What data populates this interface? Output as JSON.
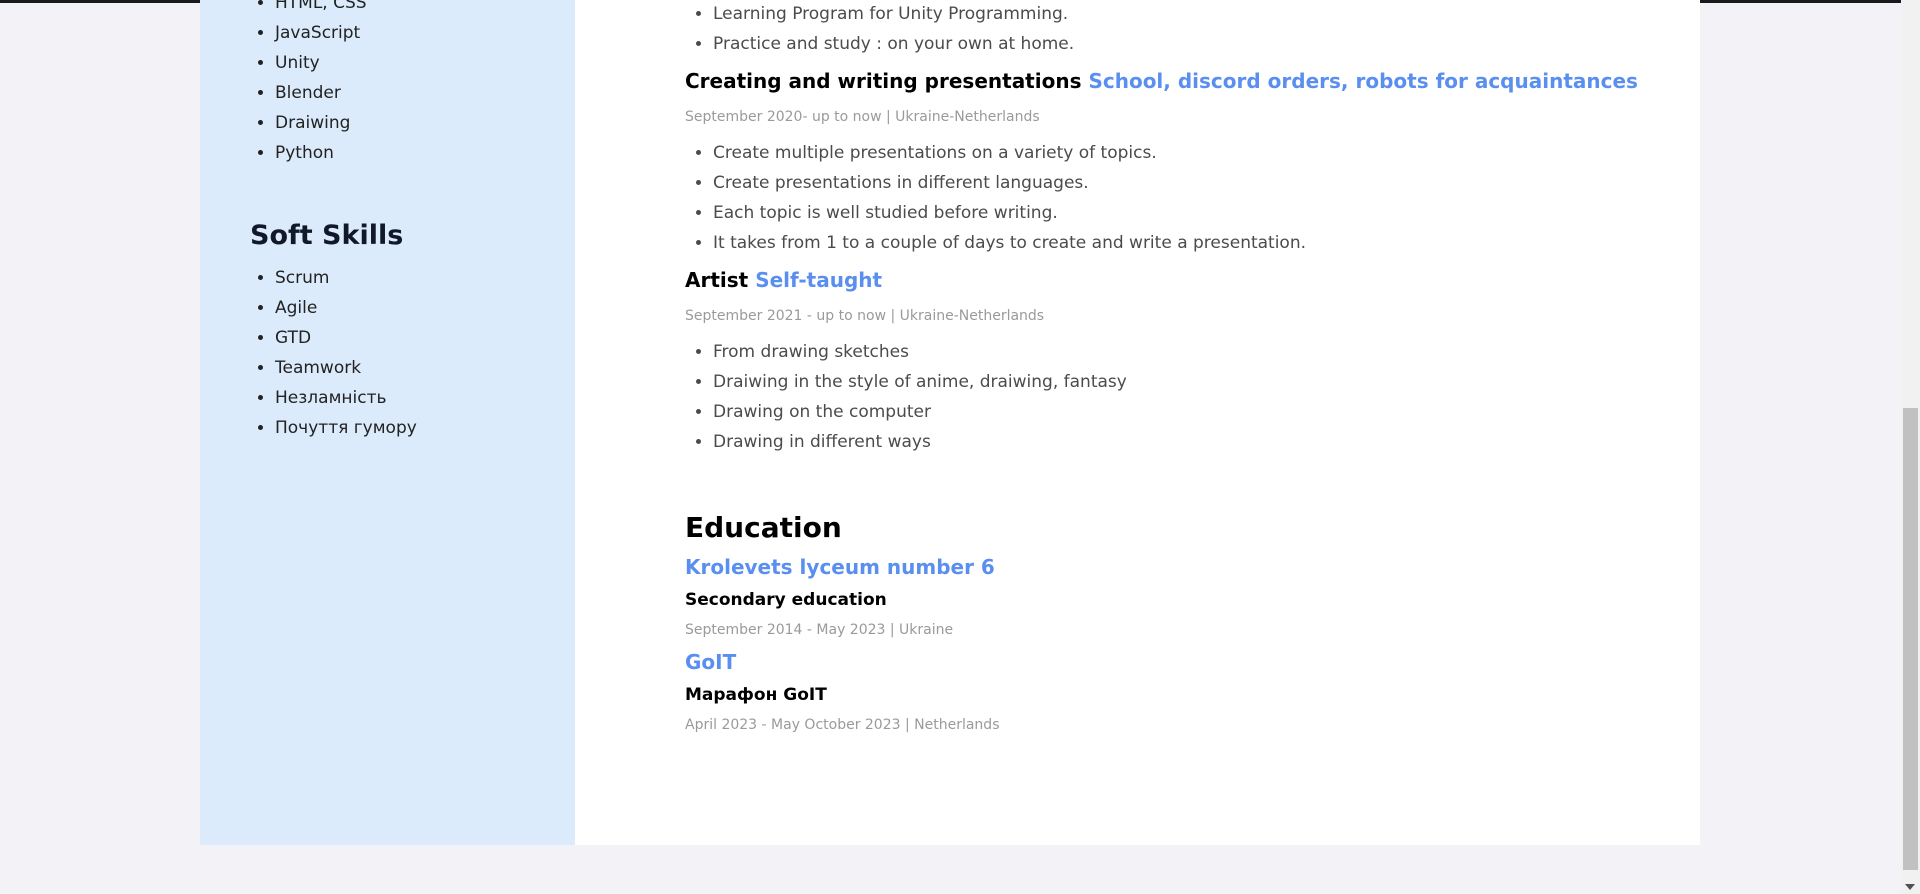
{
  "sidebar": {
    "hard_skills": [
      "HTML, CSS",
      "JavaScript",
      "Unity",
      "Blender",
      "Draiwing",
      "Python"
    ],
    "soft_skills_title": "Soft Skills",
    "soft_skills": [
      "Scrum",
      "Agile",
      "GTD",
      "Teamwork",
      "Незламність",
      "Почуття гумору"
    ]
  },
  "experience": {
    "top_bullets": [
      "Learning Program for Unity Programming.",
      "Practice and study : on your own at home."
    ],
    "jobs": [
      {
        "title": "Creating and writing presentations",
        "org": "School, discord orders, robots for acquaintances",
        "meta": "September 2020- up to now | Ukraine-Netherlands",
        "bullets": [
          "Create multiple presentations on a variety of topics.",
          "Create presentations in different languages.",
          "Each topic is well studied before writing.",
          "It takes from 1 to a couple of days to create and write a presentation."
        ]
      },
      {
        "title": "Artist",
        "org": "Self-taught",
        "meta": "September 2021 - up to now | Ukraine-Netherlands",
        "bullets": [
          "From drawing sketches",
          "Draiwing in the style of anime, draiwing, fantasy",
          "Drawing on the computer",
          "Drawing in different ways"
        ]
      }
    ]
  },
  "education": {
    "title": "Education",
    "items": [
      {
        "name": "Krolevets lyceum number 6",
        "degree": "Secondary education",
        "meta": "September 2014 - May 2023 | Ukraine"
      },
      {
        "name": "GoIT",
        "degree": "Марафон GoIT",
        "meta": "April 2023 - May October 2023 | Netherlands"
      }
    ]
  },
  "icons": {
    "scroll_down": "triangle-down-icon"
  },
  "colors": {
    "accent": "#5a8ff0",
    "sidebar_bg": "#dcebfc",
    "page_bg": "#f3f3f7",
    "meta_text": "#9a9a9a"
  }
}
